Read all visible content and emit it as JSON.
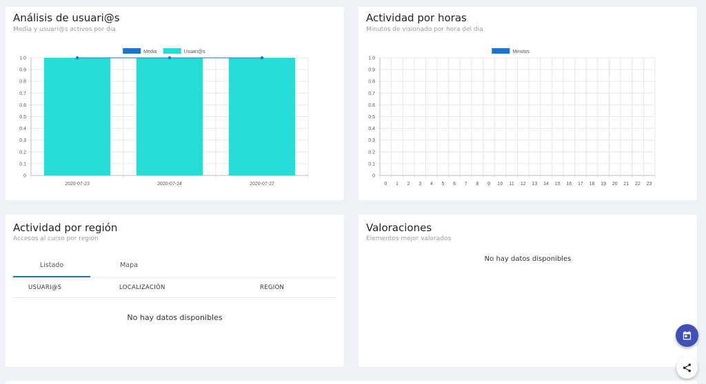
{
  "users_card": {
    "title": "Análisis de usuari@s",
    "subtitle": "Media y usuari@s activos por dia",
    "legend": [
      "Media",
      "Usuari@s"
    ],
    "colors": {
      "media": "#1a73d6",
      "usuarios": "#26ddd5"
    }
  },
  "hours_card": {
    "title": "Actividad por horas",
    "subtitle": "Minutos de visionado por hora del dia",
    "legend": [
      "Minutos"
    ],
    "colors": {
      "minutos": "#1a73d6"
    }
  },
  "region_card": {
    "title": "Actividad por región",
    "subtitle": "Accesos al curso por región",
    "tabs": [
      "Listado",
      "Mapa"
    ],
    "active_tab": "Listado",
    "columns": [
      "USUARI@S",
      "LOCALIZACIÓN",
      "REGIÓN"
    ],
    "empty_message": "No hay datos disponibles"
  },
  "ratings_card": {
    "title": "Valoraciones",
    "subtitle": "Elementos mejor valorados",
    "empty_message": "No hay datos disponibles"
  },
  "fabs": {
    "calendar_color": "#3f51b5",
    "share_color": "#ffffff"
  },
  "chart_data": [
    {
      "type": "bar",
      "categories": [
        "2020-07-23",
        "2020-07-24",
        "2020-07-27"
      ],
      "series": [
        {
          "name": "Media",
          "type": "line",
          "values": [
            1,
            1,
            1
          ]
        },
        {
          "name": "Usuari@s",
          "type": "bar",
          "values": [
            1,
            1,
            1
          ]
        }
      ],
      "yticks": [
        "0",
        "0.1",
        "0.2",
        "0.3",
        "0.4",
        "0.5",
        "0.6",
        "0.7",
        "0.8",
        "0.9",
        "1.0"
      ],
      "ylim": [
        0,
        1
      ],
      "grid": true,
      "legend": "top-center"
    },
    {
      "type": "line",
      "categories": [
        "0",
        "1",
        "2",
        "3",
        "4",
        "5",
        "6",
        "7",
        "8",
        "9",
        "10",
        "11",
        "12",
        "13",
        "14",
        "15",
        "16",
        "17",
        "18",
        "19",
        "20",
        "21",
        "22",
        "23"
      ],
      "series": [
        {
          "name": "Minutos",
          "values": []
        }
      ],
      "yticks": [
        "0",
        "0.1",
        "0.2",
        "0.3",
        "0.4",
        "0.5",
        "0.6",
        "0.7",
        "0.8",
        "0.9",
        "1.0"
      ],
      "ylim": [
        0,
        1
      ],
      "grid": true,
      "legend": "top-center"
    }
  ]
}
